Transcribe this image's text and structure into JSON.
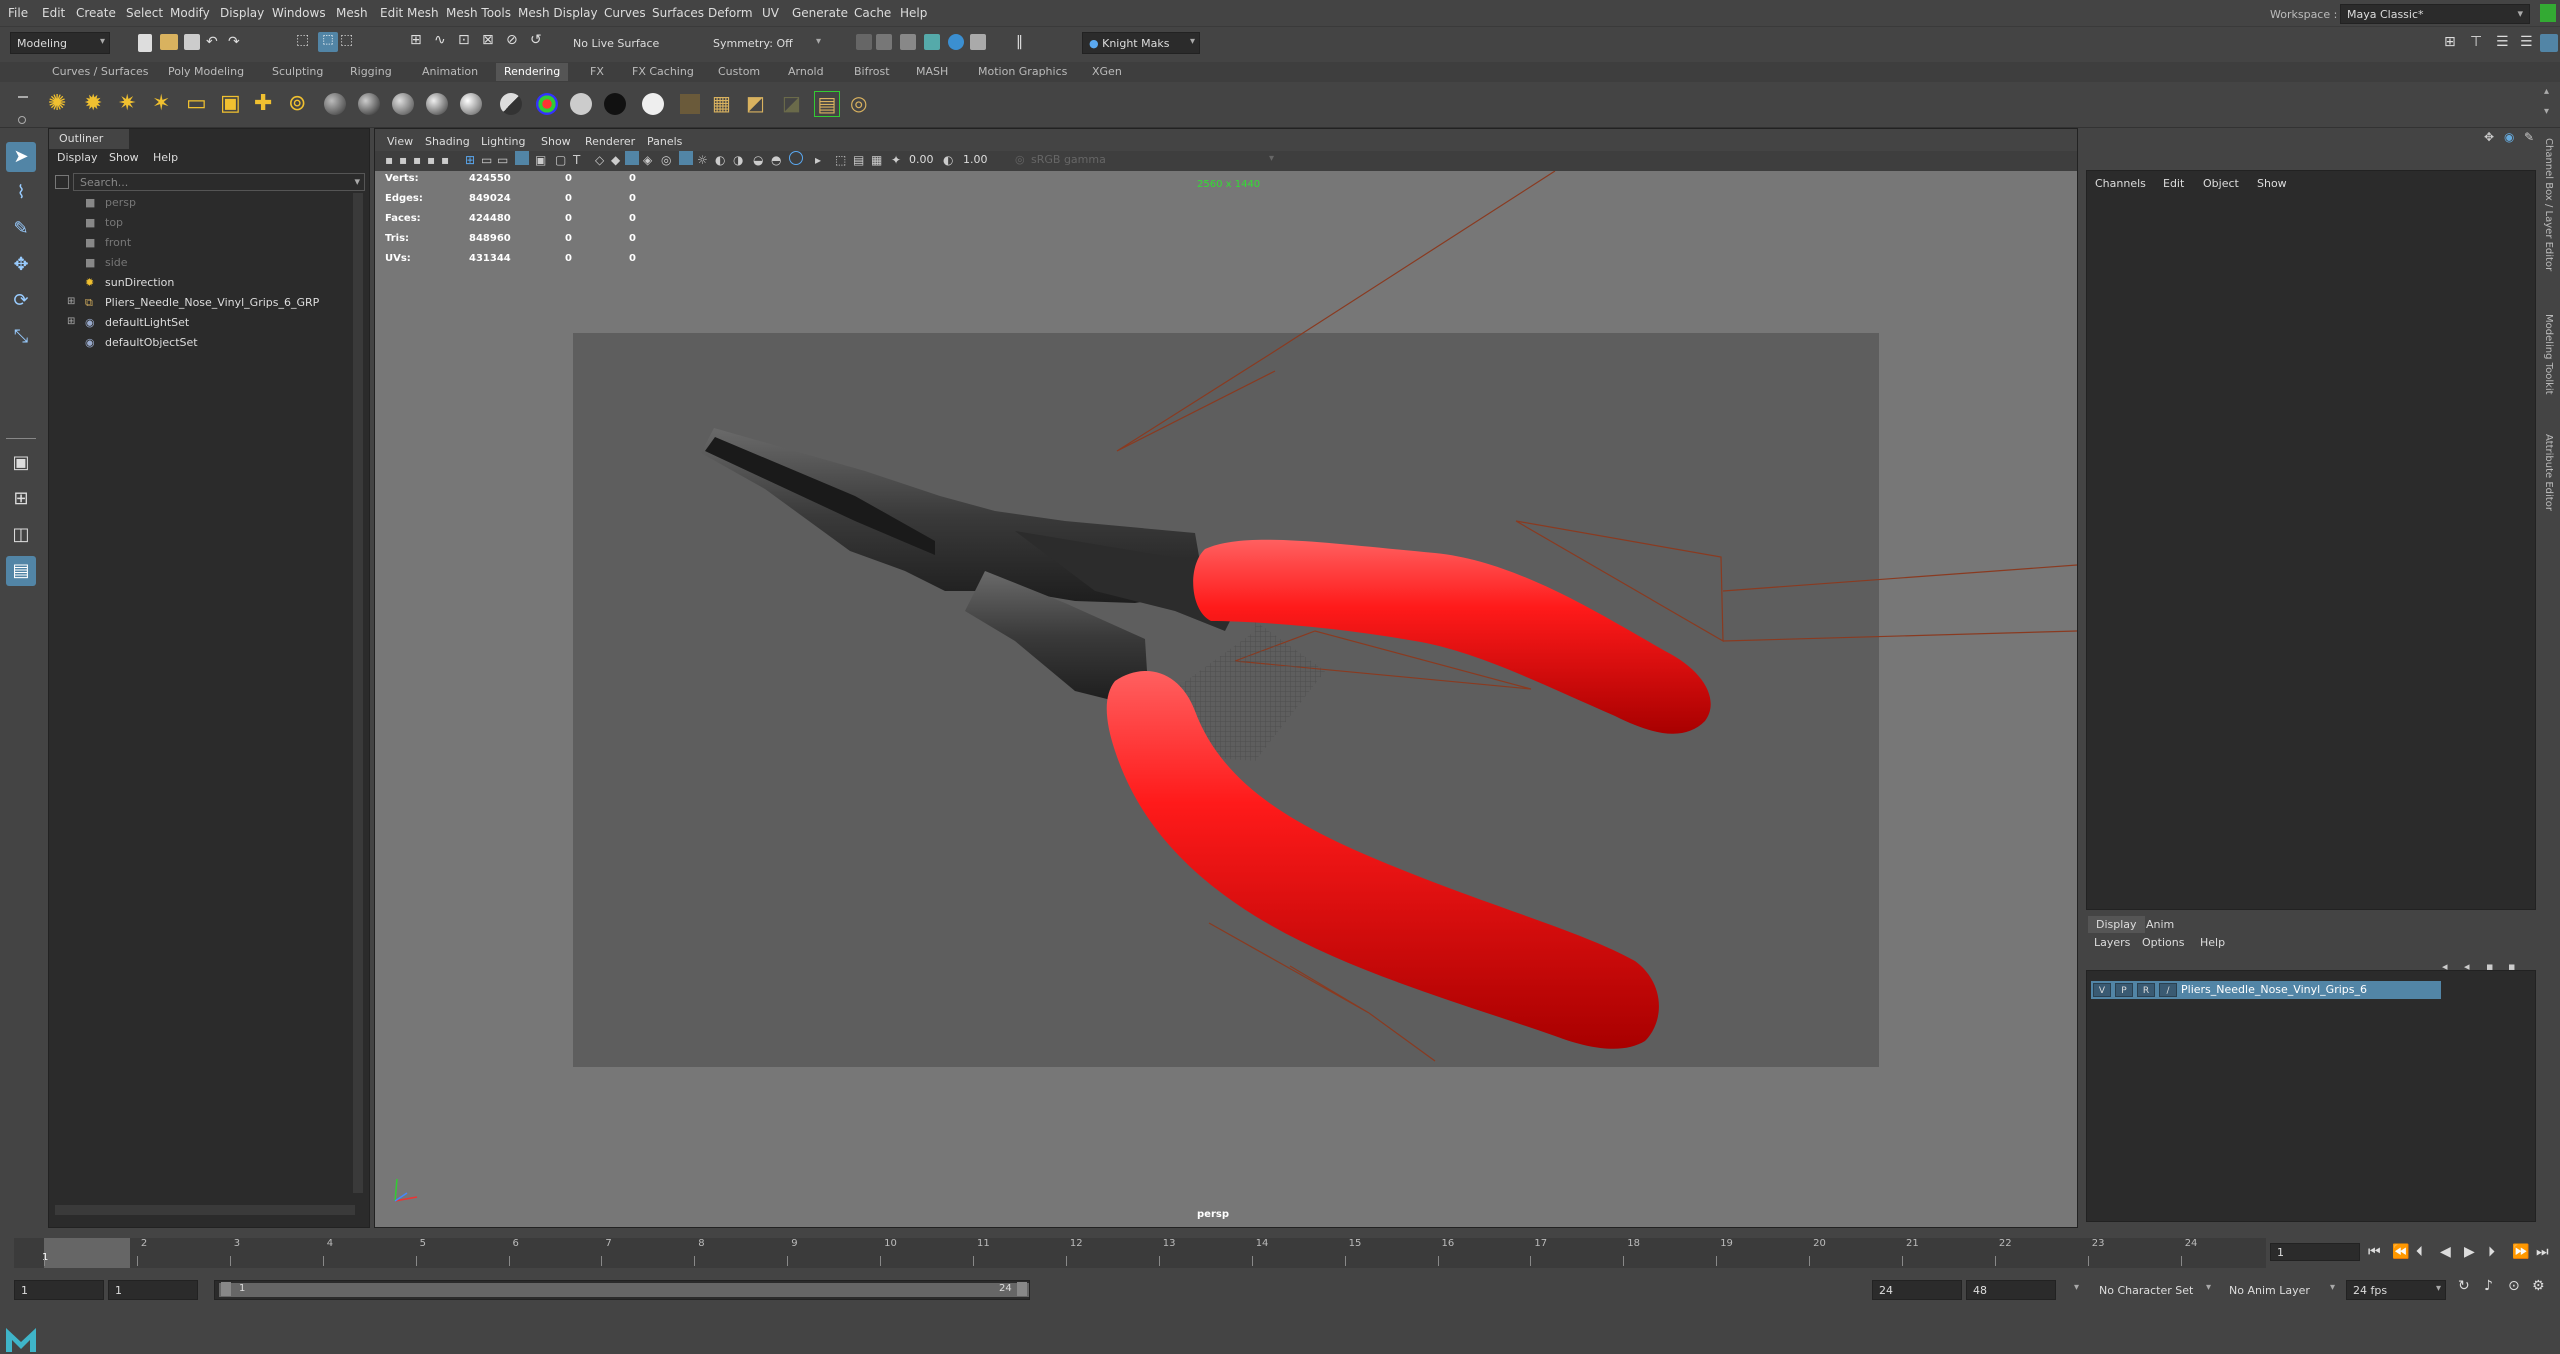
{
  "menubar": {
    "items": [
      "File",
      "Edit",
      "Create",
      "Select",
      "Modify",
      "Display",
      "Windows",
      "Mesh",
      "Edit Mesh",
      "Mesh Tools",
      "Mesh Display",
      "Curves",
      "Surfaces",
      "Deform",
      "UV",
      "Generate",
      "Cache",
      "Help"
    ],
    "workspace_label": "Workspace :",
    "workspace_value": "Maya Classic*"
  },
  "statusline": {
    "mode": "Modeling",
    "live_surface": "No Live Surface",
    "symmetry": "Symmetry: Off",
    "user": "Knight Maks"
  },
  "shelf": {
    "tabs": [
      "Curves / Surfaces",
      "Poly Modeling",
      "Sculpting",
      "Rigging",
      "Animation",
      "Rendering",
      "FX",
      "FX Caching",
      "Custom",
      "Arnold",
      "Bifrost",
      "MASH",
      "Motion Graphics",
      "XGen"
    ],
    "active_tab": "Rendering"
  },
  "outliner": {
    "title": "Outliner",
    "menu": [
      "Display",
      "Show",
      "Help"
    ],
    "search_placeholder": "Search...",
    "items": [
      {
        "label": "persp",
        "dim": true
      },
      {
        "label": "top",
        "dim": true
      },
      {
        "label": "front",
        "dim": true
      },
      {
        "label": "side",
        "dim": true
      },
      {
        "label": "sunDirection",
        "dim": false
      },
      {
        "label": "Pliers_Needle_Nose_Vinyl_Grips_6_GRP",
        "dim": false
      },
      {
        "label": "defaultLightSet",
        "dim": false
      },
      {
        "label": "defaultObjectSet",
        "dim": false
      }
    ]
  },
  "viewport": {
    "menu": [
      "View",
      "Shading",
      "Lighting",
      "Show",
      "Renderer",
      "Panels"
    ],
    "exposure": "0.00",
    "gamma": "1.00",
    "color_space": "sRGB gamma",
    "resolution": "2560 x 1440",
    "camera": "persp",
    "stats": [
      {
        "label": "Verts:",
        "value": "424550",
        "a": "0",
        "b": "0"
      },
      {
        "label": "Edges:",
        "value": "849024",
        "a": "0",
        "b": "0"
      },
      {
        "label": "Faces:",
        "value": "424480",
        "a": "0",
        "b": "0"
      },
      {
        "label": "Tris:",
        "value": "848960",
        "a": "0",
        "b": "0"
      },
      {
        "label": "UVs:",
        "value": "431344",
        "a": "0",
        "b": "0"
      }
    ]
  },
  "channelbox": {
    "menu": [
      "Channels",
      "Edit",
      "Object",
      "Show"
    ],
    "tabs": [
      "Display",
      "Anim"
    ],
    "active_tab": "Display",
    "layer_menu": [
      "Layers",
      "Options",
      "Help"
    ],
    "layer": {
      "v": "V",
      "p": "P",
      "r": "R",
      "name": "Pliers_Needle_Nose_Vinyl_Grips_6"
    },
    "side_tabs": [
      "Channel Box / Layer Editor",
      "Modeling Toolkit",
      "Attribute Editor"
    ]
  },
  "timeslider": {
    "ticks": [
      "1",
      "2",
      "3",
      "4",
      "5",
      "6",
      "7",
      "8",
      "9",
      "10",
      "11",
      "12",
      "13",
      "14",
      "15",
      "16",
      "17",
      "18",
      "19",
      "20",
      "21",
      "22",
      "23",
      "24"
    ],
    "current_frame": "1",
    "current_field": "1"
  },
  "rangeslider": {
    "start": "1",
    "playback_start": "1",
    "range_start": "1",
    "range_end": "24",
    "playback_end": "24",
    "end": "48",
    "character_set": "No Character Set",
    "anim_layer": "No Anim Layer",
    "fps": "24 fps"
  },
  "colors": {
    "grip_red": "#ff1a1a",
    "metal": "#3a3a3a",
    "accent_blue": "#5285a6",
    "active_green": "#3d3"
  }
}
